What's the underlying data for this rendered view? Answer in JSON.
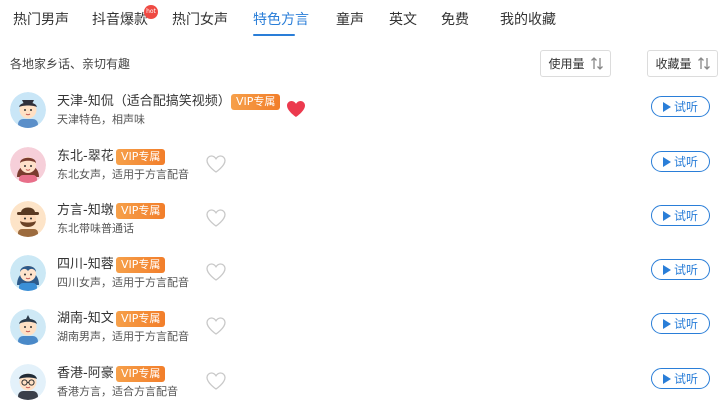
{
  "tabs": [
    {
      "label": "热门男声"
    },
    {
      "label": "抖音爆款",
      "badge": "hot"
    },
    {
      "label": "热门女声"
    },
    {
      "label": "特色方言",
      "active": true
    },
    {
      "label": "童声"
    },
    {
      "label": "英文"
    },
    {
      "label": "免费"
    },
    {
      "label": "我的收藏"
    }
  ],
  "subtitle": "各地家乡话、亲切有趣",
  "sort": {
    "usage_label": "使用量",
    "favorites_label": "收藏量"
  },
  "vip_label": "VIP专属",
  "listen_label": "试听",
  "colors": {
    "accent": "#2a7ed8",
    "vip": "#f27e2a",
    "favorite_active": "#ec3a4e",
    "favorite_inactive": "#c8c8c8"
  },
  "voices": [
    {
      "name": "天津-知侃（适合配搞笑视频）",
      "desc": "天津特色，相声味",
      "favorited": true,
      "avatar": "tianjin-male-avatar"
    },
    {
      "name": "东北-翠花",
      "desc": "东北女声，适用于方言配音",
      "favorited": false,
      "avatar": "dongbei-female-avatar"
    },
    {
      "name": "方言-知墩",
      "desc": "东北带味普通话",
      "favorited": false,
      "avatar": "bearded-male-avatar"
    },
    {
      "name": "四川-知蓉",
      "desc": "四川女声，适用于方言配音",
      "favorited": false,
      "avatar": "sichuan-female-avatar"
    },
    {
      "name": "湖南-知文",
      "desc": "湖南男声，适用于方言配音",
      "favorited": false,
      "avatar": "hunan-male-avatar"
    },
    {
      "name": "香港-阿豪",
      "desc": "香港方言，适合方言配音",
      "favorited": false,
      "avatar": "hongkong-male-avatar"
    }
  ]
}
